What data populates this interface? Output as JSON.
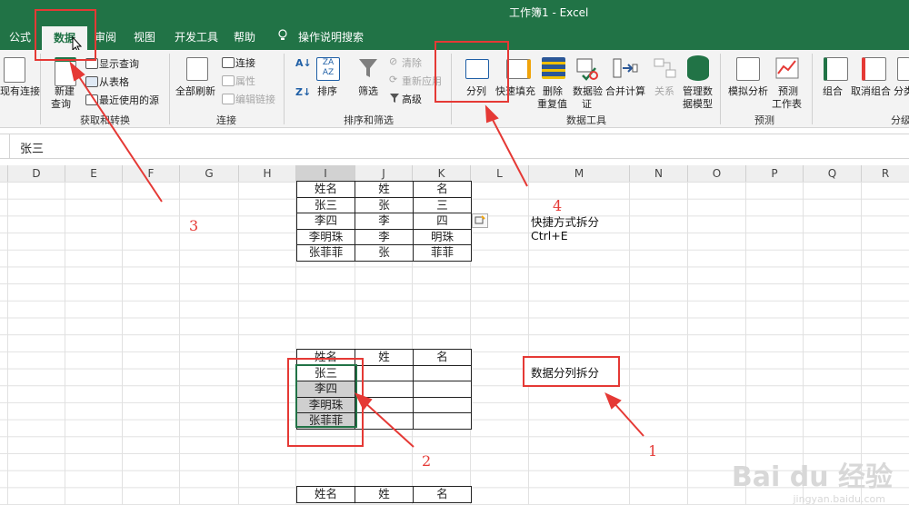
{
  "window": {
    "title": "工作簿1  -  Excel"
  },
  "tabs": [
    {
      "label": "公式"
    },
    {
      "label": "数据"
    },
    {
      "label": "审阅"
    },
    {
      "label": "视图"
    },
    {
      "label": "开发工具"
    },
    {
      "label": "帮助"
    },
    {
      "label": "操作说明搜索"
    }
  ],
  "ribbon": {
    "get_transform": {
      "existing_connections": "现有连接",
      "new_query_1": "新建",
      "new_query_2": "查询",
      "show_queries": "显示查询",
      "from_table": "从表格",
      "recent_sources": "最近使用的源",
      "group": "获取和转换"
    },
    "connections": {
      "refresh_all": "全部刷新",
      "connections": "连接",
      "properties": "属性",
      "edit_links": "编辑链接",
      "group": "连接"
    },
    "sort_filter": {
      "sort": "排序",
      "filter": "筛选",
      "clear": "清除",
      "reapply": "重新应用",
      "advanced": "高级",
      "group": "排序和筛选"
    },
    "data_tools": {
      "text_to_columns": "分列",
      "flash_fill": "快速填充",
      "remove_dup_1": "删除",
      "remove_dup_2": "重复值",
      "validation_1": "数据验",
      "validation_2": "证",
      "consolidate": "合并计算",
      "relationships": "关系",
      "manage_model_1": "管理数",
      "manage_model_2": "据模型",
      "group": "数据工具"
    },
    "forecast": {
      "what_if": "模拟分析",
      "forecast_sheet_1": "预测",
      "forecast_sheet_2": "工作表",
      "group": "预测"
    },
    "outline": {
      "group_btn": "组合",
      "ungroup": "取消组合",
      "subtotal": "分类",
      "group": "分级"
    }
  },
  "formula_bar": {
    "value": "张三"
  },
  "columns": [
    "D",
    "E",
    "F",
    "G",
    "H",
    "I",
    "J",
    "K",
    "L",
    "M",
    "N",
    "O",
    "P",
    "Q",
    "R"
  ],
  "table1": {
    "header": [
      "姓名",
      "姓",
      "名"
    ],
    "rows": [
      [
        "张三",
        "张",
        "三"
      ],
      [
        "李四",
        "李",
        "四"
      ],
      [
        "李明珠",
        "李",
        "明珠"
      ],
      [
        "张菲菲",
        "张",
        "菲菲"
      ]
    ]
  },
  "table2": {
    "header": [
      "姓名",
      "姓",
      "名"
    ],
    "rows": [
      [
        "张三",
        "",
        ""
      ],
      [
        "李四",
        "",
        ""
      ],
      [
        "李明珠",
        "",
        ""
      ],
      [
        "张菲菲",
        "",
        ""
      ]
    ]
  },
  "table3": {
    "header": [
      "姓名",
      "姓",
      "名"
    ]
  },
  "notes": {
    "shortcut": "快捷方式拆分",
    "shortcut_keys": "Ctrl+E",
    "split_columns": "数据分列拆分",
    "step1": "1",
    "step2": "2",
    "step3": "3",
    "step4": "4"
  },
  "watermark": {
    "logo": "Bai du 经验",
    "url": "jingyan.baidu.com"
  },
  "colors": {
    "excel_green": "#217346",
    "annotation_red": "#e53935"
  }
}
